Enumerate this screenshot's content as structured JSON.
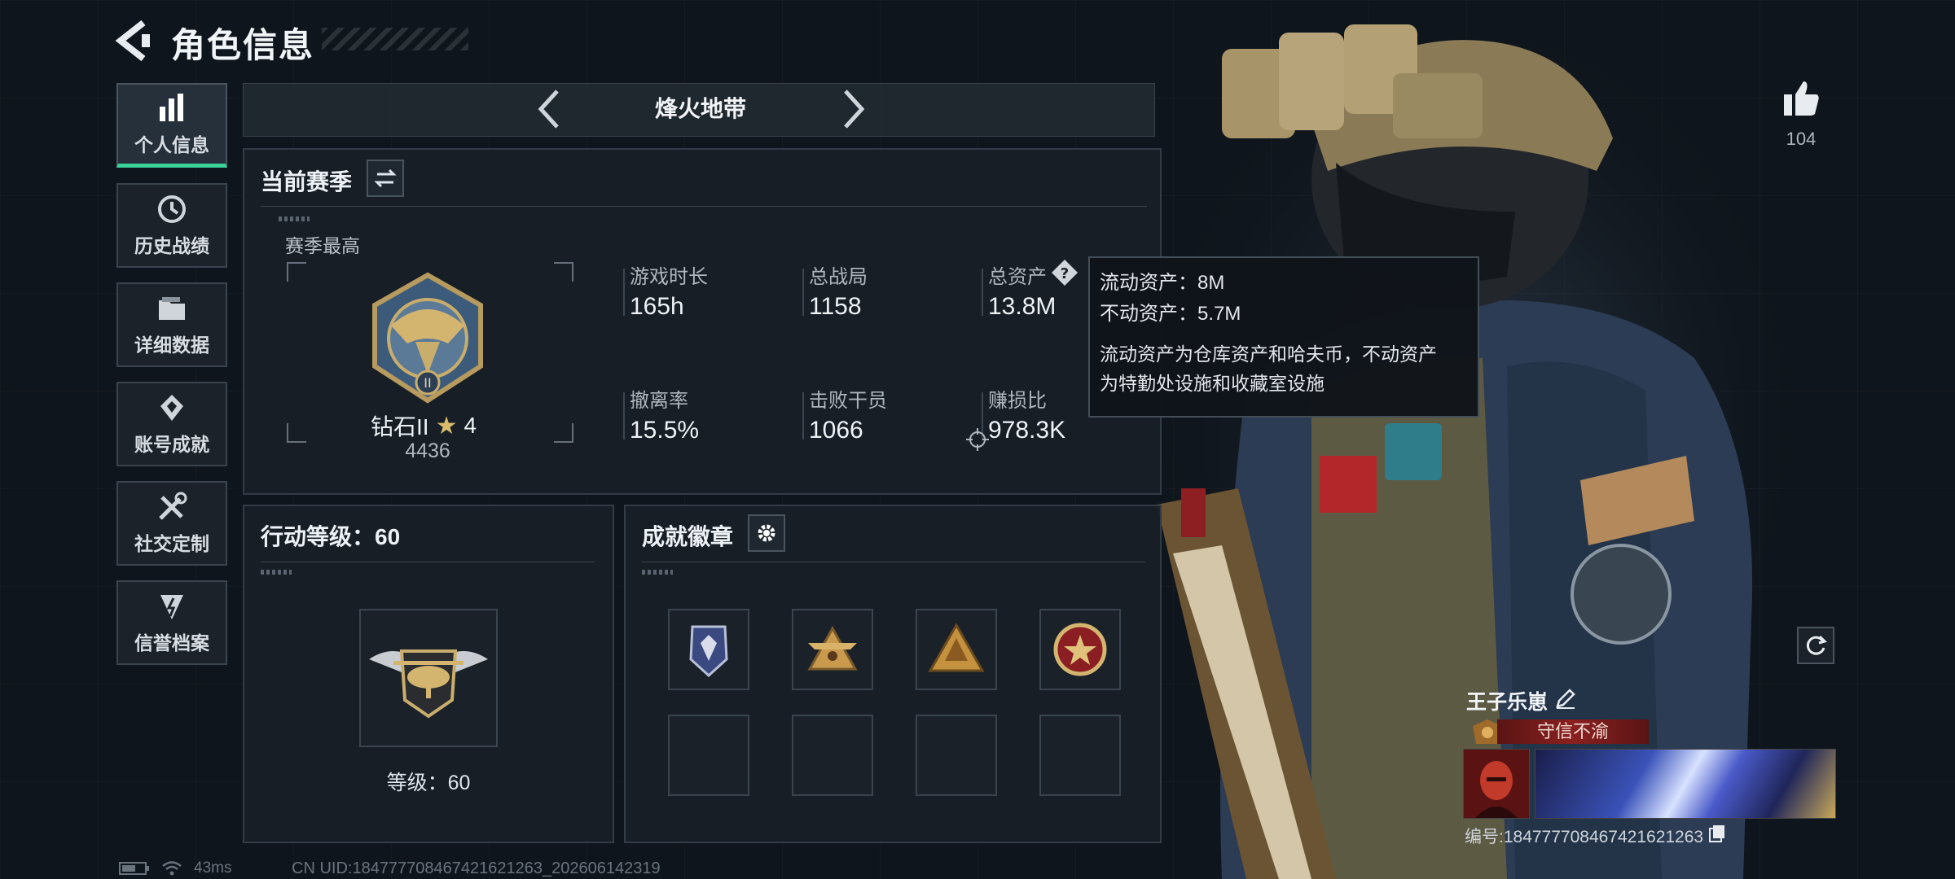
{
  "header": {
    "title": "角色信息"
  },
  "sidebar": {
    "items": [
      {
        "label": "个人信息",
        "icon": "bar-chart-icon",
        "active": true
      },
      {
        "label": "历史战绩",
        "icon": "history-clock-icon",
        "active": false
      },
      {
        "label": "详细数据",
        "icon": "folder-icon",
        "active": false
      },
      {
        "label": "账号成就",
        "icon": "achievement-icon",
        "active": false
      },
      {
        "label": "社交定制",
        "icon": "wrench-icon",
        "active": false
      },
      {
        "label": "信誉档案",
        "icon": "shield-badge-icon",
        "active": false
      }
    ]
  },
  "mode": {
    "name": "烽火地带"
  },
  "season": {
    "title": "当前赛季",
    "best_label": "赛季最高",
    "rank_name": "钻石II",
    "rank_stars": "4",
    "rank_score": "4436",
    "stats": [
      {
        "label": "游戏时长",
        "value": "165h"
      },
      {
        "label": "总战局",
        "value": "1158"
      },
      {
        "label": "总资产",
        "value": "13.8M"
      },
      {
        "label": "撤离率",
        "value": "15.5%"
      },
      {
        "label": "击败干员",
        "value": "1066"
      },
      {
        "label": "赚损比",
        "value": "978.3K"
      }
    ]
  },
  "tooltip": {
    "liquid": "流动资产：8M",
    "fixed": "不动资产：5.7M",
    "desc_line1": "流动资产为仓库资产和哈夫币，不动资产",
    "desc_line2": "为特勤处设施和收藏室设施"
  },
  "action_level": {
    "title": "行动等级：60",
    "level_text": "等级：60"
  },
  "achievements": {
    "title": "成就徽章",
    "badges": [
      "shield-crest-badge",
      "winged-triangle-badge",
      "mountain-triangle-badge",
      "star-wreath-badge"
    ],
    "empty_slots": 4
  },
  "likes": {
    "count": "104"
  },
  "player": {
    "name": "王子乐崽",
    "title_tag": "守信不渝",
    "id_text": "编号:184777708467421621263"
  },
  "footer": {
    "ping": "43ms",
    "uid": "CN UID:184777708467421621263_202606142319"
  },
  "colors": {
    "accent": "#3bd19a",
    "panel": "#181f27",
    "tag_red": "#7a1c1c"
  }
}
